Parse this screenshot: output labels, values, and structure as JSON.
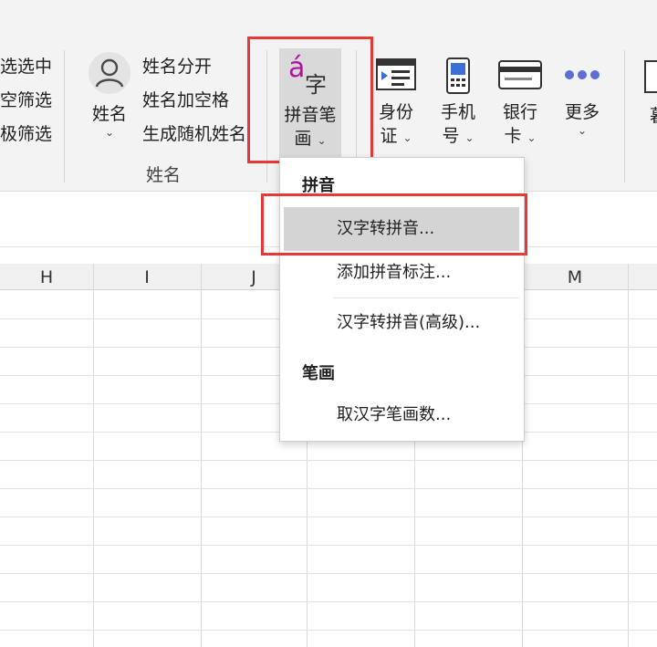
{
  "ribbon": {
    "filter_partial": [
      "选选中",
      "空筛选",
      "极筛选"
    ],
    "name_button_label": "姓名",
    "name_items": [
      "姓名分开",
      "姓名加空格",
      "生成随机姓名"
    ],
    "name_group_label": "姓名",
    "pinyin_icon_a": "á",
    "pinyin_icon_zi": "字",
    "pinyin_button_line1": "拼音笔",
    "pinyin_button_line2": "画",
    "id_card_line1": "身份",
    "id_card_line2": "证",
    "phone_line1": "手机",
    "phone_line2": "号",
    "bank_line1": "银行",
    "bank_line2": "卡",
    "more_label": "更多",
    "partial_right": "暮"
  },
  "columns": [
    "H",
    "I",
    "J",
    "M"
  ],
  "menu": {
    "section_pinyin": "拼音",
    "item_hanzi_to_pinyin": "汉字转拼音...",
    "item_add_pinyin_annotation": "添加拼音标注...",
    "item_hanzi_to_pinyin_advanced": "汉字转拼音(高级)...",
    "section_strokes": "笔画",
    "item_get_stroke_count": "取汉字笔画数..."
  },
  "colors": {
    "highlight": "#e53935",
    "accent_icon": "#b0159f",
    "more_dots": "#5b6fd6"
  }
}
